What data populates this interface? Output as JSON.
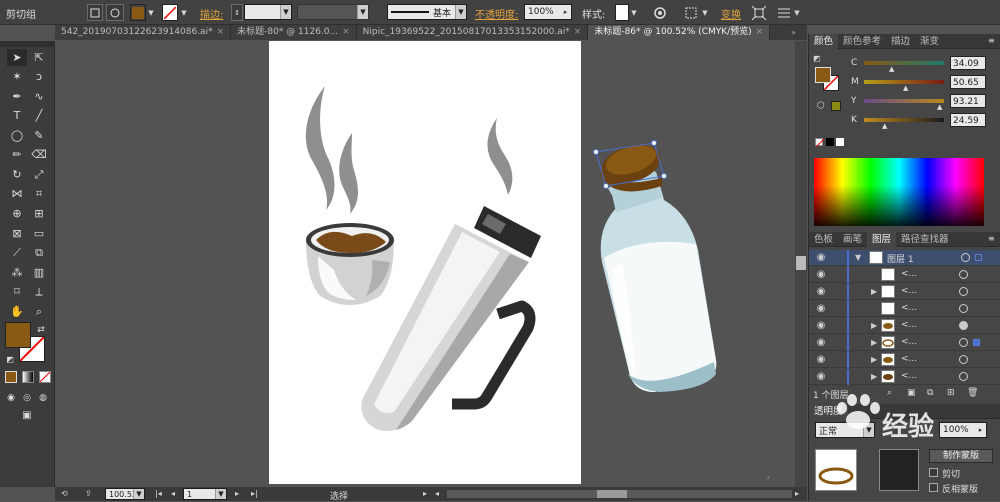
{
  "control_bar": {
    "selection_label": "剪切组",
    "stroke_label": "描边:",
    "stroke_style": "基本",
    "opacity_label": "不透明度:",
    "opacity_value": "100%",
    "style_label": "样式:",
    "transform_label": "变换",
    "fill_color": "#8a5a14"
  },
  "tabs": [
    {
      "label": "542_20190703122623914086.ai*"
    },
    {
      "label": "未标题-80* @ 1126.0..."
    },
    {
      "label": "Nipic_19369522_20150817013353152000.ai*"
    },
    {
      "label": "未标题-86* @ 100.52% (CMYK/预览)",
      "active": true
    }
  ],
  "status": {
    "zoom": "100.52",
    "page": "1",
    "tool": "选择"
  },
  "color_panel": {
    "tabs": [
      "颜色",
      "颜色参考",
      "描边",
      "渐变"
    ],
    "channels": [
      {
        "name": "C",
        "value": "34.09"
      },
      {
        "name": "M",
        "value": "50.65"
      },
      {
        "name": "Y",
        "value": "93.21"
      },
      {
        "name": "K",
        "value": "24.59"
      }
    ],
    "fill_color": "#8a5a14"
  },
  "layers_panel": {
    "tabs": [
      "色板",
      "画笔",
      "图层",
      "路径查找器"
    ],
    "top_layer": "图层 1",
    "rows": [
      "<...",
      "<...",
      "<...",
      "<...",
      "<...",
      "<...",
      "<...",
      "<..."
    ],
    "footer": "1 个图层"
  },
  "transparency_panel": {
    "title": "透明度",
    "mode": "正常",
    "opacity": "100%",
    "make_mask": "制作蒙版",
    "clip": "剪切",
    "invert_mask": "反相蒙版"
  },
  "watermark": "经验"
}
